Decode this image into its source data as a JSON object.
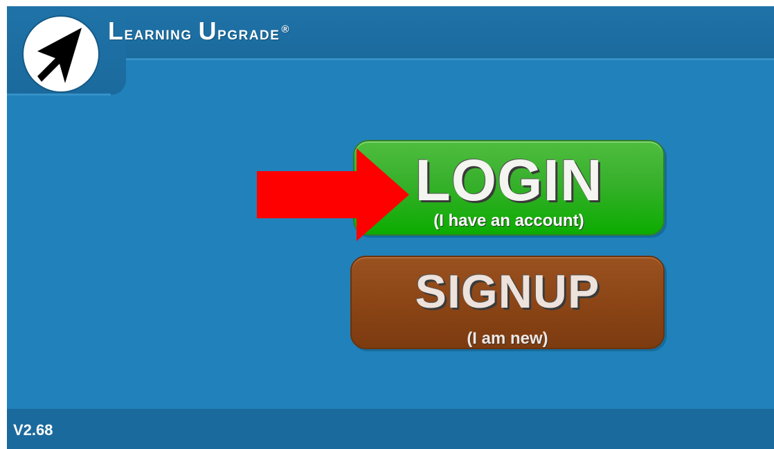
{
  "brand": {
    "title_first_initial": "L",
    "title_first_rest": "earning",
    "title_second_initial": "U",
    "title_second_rest": "pgrade",
    "registered": "®",
    "logo_icon": "cursor-arrow-icon"
  },
  "login_button": {
    "label": "LOGIN",
    "sublabel": "(I have an account)",
    "color": "#0cac00"
  },
  "signup_button": {
    "label": "SIGNUP",
    "sublabel": "(I am new)",
    "color": "#8a4415"
  },
  "pointer_arrow": {
    "icon": "red-arrow-icon",
    "color": "#ff0000"
  },
  "footer": {
    "version": "V2.68"
  },
  "colors": {
    "background": "#2181ba",
    "header": "#1b6a9d"
  }
}
